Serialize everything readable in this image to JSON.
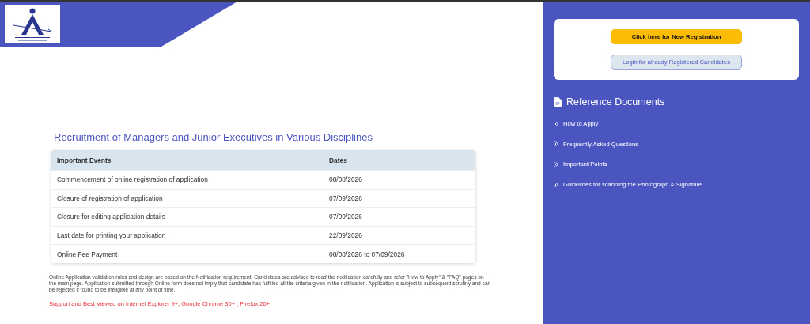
{
  "title": "Recruitment of Managers and Junior Executives in Various Disciplines",
  "table": {
    "columns": [
      "Important Events",
      "Dates"
    ],
    "rows": [
      [
        "Commencement of online registration of application",
        "08/08/2026"
      ],
      [
        "Closure of registration of application",
        "07/09/2026"
      ],
      [
        "Closure for editing application details",
        "07/09/2026"
      ],
      [
        "Last date for printing your application",
        "22/09/2026"
      ],
      [
        "Online Fee Payment",
        "08/08/2026 to 07/09/2026"
      ]
    ]
  },
  "notice": "Online Application validation rules and design are based on the Notification requirement. Candidates are advised to read the notification carefully and refer \"How to Apply\" & \"FAQ\" pages on the main page. Application submitted through Online form does not imply that candidate has fulfilled all the criteria given in the notification. Application is subject to subsequent scrutiny and can be rejected if found to be ineligible at any point of time.",
  "browser_note": "Support and Best Viewed on Internet Explorer 9+; Google Chrome 30+ ; Firefox 20+",
  "buttons": [
    {
      "kind": "primary",
      "label": "Click here for New Registration"
    },
    {
      "kind": "secondary",
      "label": "Login for already Registered Candidates"
    }
  ],
  "reference": {
    "title": "Reference Documents",
    "items": [
      "How to Apply",
      "Frequently Asked Questions",
      "Important Points",
      "Guidelines for scanning the Photograph & Signature"
    ]
  }
}
